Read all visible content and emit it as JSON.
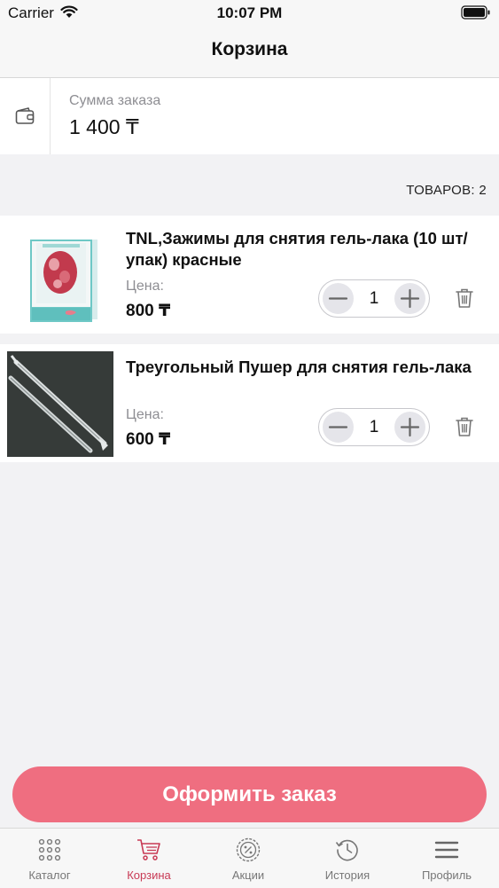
{
  "status_bar": {
    "carrier": "Carrier",
    "time": "10:07 PM",
    "icons": [
      "wifi-icon",
      "battery-icon"
    ]
  },
  "nav": {
    "title": "Корзина"
  },
  "summary": {
    "label": "Сумма заказа",
    "value": "1 400 ₸",
    "icon": "wallet-icon"
  },
  "cart": {
    "count_label": "ТОВАРОВ: 2",
    "items": [
      {
        "name": "TNL,Зажимы для снятия гель-лака (10 шт/упак) красные",
        "price_label": "Цена:",
        "price": "800 ₸",
        "quantity": "1"
      },
      {
        "name": "Треугольный Пушер для снятия гель-лака",
        "price_label": "Цена:",
        "price": "600 ₸",
        "quantity": "1"
      }
    ]
  },
  "checkout": {
    "label": "Оформить заказ"
  },
  "tabs": [
    {
      "label": "Каталог",
      "icon": "grid-icon",
      "active": false
    },
    {
      "label": "Корзина",
      "icon": "cart-icon",
      "active": true
    },
    {
      "label": "Акции",
      "icon": "percent-badge-icon",
      "active": false
    },
    {
      "label": "История",
      "icon": "history-icon",
      "active": false
    },
    {
      "label": "Профиль",
      "icon": "menu-icon",
      "active": false
    }
  ],
  "colors": {
    "accent": "#ef6e80",
    "active_tab": "#c83a55",
    "background": "#f2f2f4",
    "muted_text": "#8e8e93"
  }
}
